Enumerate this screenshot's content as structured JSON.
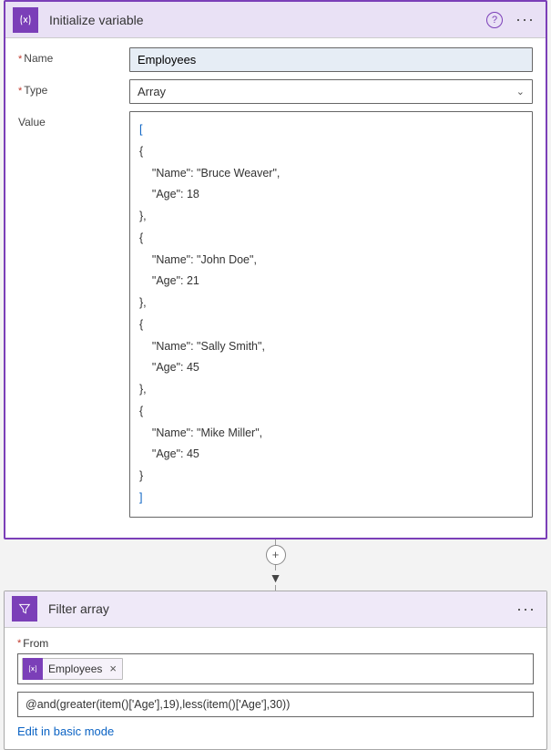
{
  "card1": {
    "title": "Initialize variable",
    "fields": {
      "name_label": "Name",
      "name_value": "Employees",
      "type_label": "Type",
      "type_value": "Array",
      "value_label": "Value",
      "value_text": "[\n{\n    \"Name\": \"Bruce Weaver\",\n    \"Age\": 18\n},\n{\n    \"Name\": \"John Doe\",\n    \"Age\": 21\n},\n{\n    \"Name\": \"Sally Smith\",\n    \"Age\": 45\n},\n{\n    \"Name\": \"Mike Miller\",\n    \"Age\": 45\n}\n]"
    },
    "value_parsed": [
      {
        "Name": "Bruce Weaver",
        "Age": 18
      },
      {
        "Name": "John Doe",
        "Age": 21
      },
      {
        "Name": "Sally Smith",
        "Age": 45
      },
      {
        "Name": "Mike Miller",
        "Age": 45
      }
    ]
  },
  "card2": {
    "title": "Filter array",
    "from_label": "From",
    "from_token": "Employees",
    "expression": "@and(greater(item()['Age'],19),less(item()['Age'],30))",
    "edit_link": "Edit in basic mode"
  },
  "colors": {
    "brand": "#7b3fb8",
    "link": "#0b63c4",
    "required": "#c0392b"
  }
}
